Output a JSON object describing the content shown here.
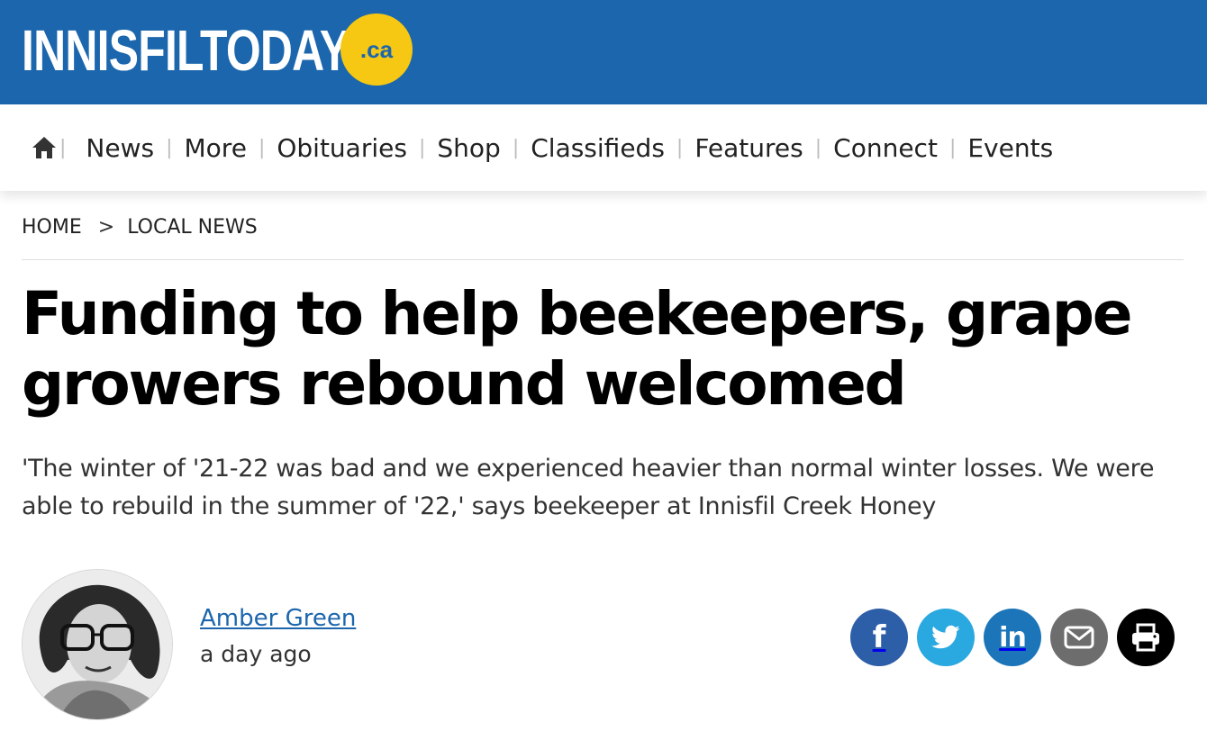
{
  "brand": {
    "name": "INNISFILTODAY",
    "tld": ".ca",
    "colors": {
      "header": "#1b66ad",
      "badge": "#f6c814",
      "link": "#1b66ad"
    }
  },
  "nav": {
    "home_icon": "home-icon",
    "items": [
      "News",
      "More",
      "Obituaries",
      "Shop",
      "Classifieds",
      "Features",
      "Connect",
      "Events"
    ]
  },
  "breadcrumb": {
    "home": "HOME",
    "separator": ">",
    "section": "LOCAL NEWS"
  },
  "article": {
    "headline": "Funding to help beekeepers, grape growers rebound welcomed",
    "subhead": "'The winter of '21-22 was bad and we experienced heavier than normal winter losses. We were able to rebuild in the summer of '22,' says beekeeper at Innisfil Creek Honey",
    "author": "Amber Green",
    "published": "a day ago"
  },
  "share": {
    "facebook": {
      "icon": "facebook-icon",
      "label": "f",
      "color": "#2d5ea8"
    },
    "twitter": {
      "icon": "twitter-icon",
      "color": "#2aa8e0"
    },
    "linkedin": {
      "icon": "linkedin-icon",
      "label": "in",
      "color": "#1b75b8"
    },
    "email": {
      "icon": "email-icon",
      "color": "#6d6d6d"
    },
    "print": {
      "icon": "print-icon",
      "color": "#000000"
    }
  }
}
